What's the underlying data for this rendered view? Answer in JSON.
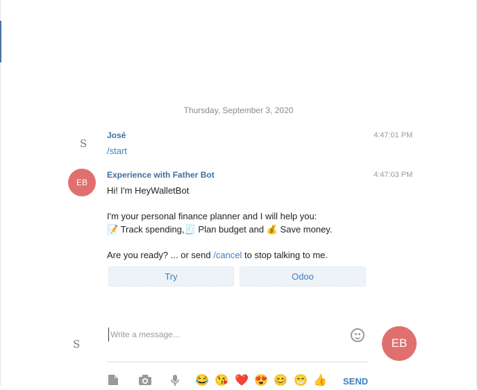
{
  "date_separator": "Thursday, September 3, 2020",
  "messages": [
    {
      "author": "José",
      "avatar": "S",
      "time": "4:47:01 PM",
      "text": "/start"
    },
    {
      "author": "Experience with Father Bot",
      "avatar": "EB",
      "time": "4:47:03 PM",
      "lines": {
        "greeting": "Hi! I'm HeyWalletBot",
        "intro": "I'm your personal finance planner and I will help you:",
        "features": {
          "f1_emoji": "📝",
          "f1_text": "Track spending,",
          "f2_emoji": "🧾",
          "f2_text": "Plan  budget and",
          "f3_emoji": "💰",
          "f3_text": "Save money."
        },
        "ready_pre": "Are you ready? ... or send",
        "ready_link": "/cancel",
        "ready_post": "to stop talking to me."
      },
      "buttons": [
        "Try",
        "Odoo"
      ]
    }
  ],
  "composer": {
    "avatar": "S",
    "placeholder": "Write a message...",
    "user_avatar": "EB",
    "toolbar_icons": [
      "file-icon",
      "camera-icon",
      "microphone-icon"
    ],
    "emojis": [
      "😂",
      "😘",
      "❤️",
      "😍",
      "😊",
      "😁",
      "👍"
    ],
    "send_label": "SEND"
  },
  "colors": {
    "accent": "#3d7fc2",
    "author": "#3d6fa3",
    "avatar_bg": "#e0706f"
  }
}
